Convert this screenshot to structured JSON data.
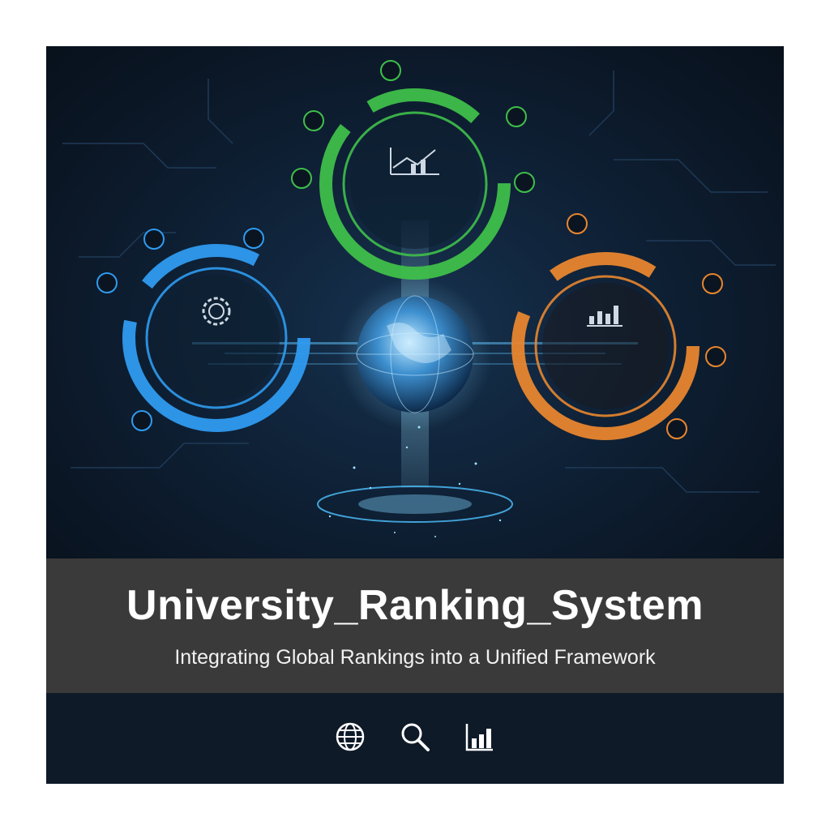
{
  "banner": {
    "title": "University_Ranking_System",
    "subtitle": "Integrating Global Rankings into a Unified Framework"
  },
  "colors": {
    "background": "#0b1521",
    "band": "#3a3a3a",
    "blue_ring": "#2f9bf0",
    "green_ring": "#3fbf4a",
    "orange_ring": "#e8862f",
    "globe_glow": "#7fd4ff"
  },
  "illustration": {
    "rings": [
      {
        "name": "blue-ring",
        "center_icon": "dollar-gear-icon"
      },
      {
        "name": "green-ring",
        "center_icon": "line-chart-icon"
      },
      {
        "name": "orange-ring",
        "center_icon": "bar-chart-icon"
      }
    ],
    "center": "globe-icon"
  },
  "footer_icons": [
    "globe-icon",
    "search-icon",
    "bar-chart-icon"
  ]
}
